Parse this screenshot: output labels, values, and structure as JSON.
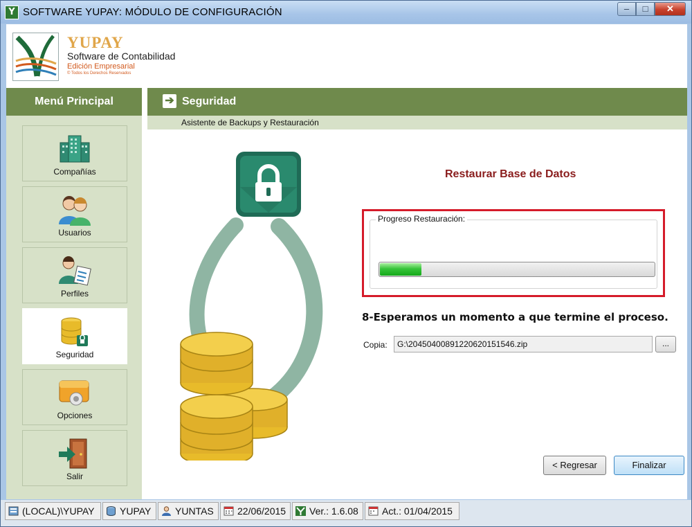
{
  "window": {
    "title": "SOFTWARE YUPAY: MÓDULO DE CONFIGURACIÓN",
    "app_icon": "Y",
    "controls": {
      "minimize": "–",
      "maximize": "□",
      "close": "✕"
    }
  },
  "header": {
    "brand": "YUPAY",
    "subtitle": "Software de Contabilidad",
    "edition": "Edición Empresarial",
    "rights": "© Todos los Derechos Reservados"
  },
  "sidebar": {
    "title": "Menú Principal",
    "items": [
      {
        "label": "Compañías",
        "icon": "buildings-icon"
      },
      {
        "label": "Usuarios",
        "icon": "users-icon"
      },
      {
        "label": "Perfiles",
        "icon": "profile-icon"
      },
      {
        "label": "Seguridad",
        "icon": "database-lock-icon",
        "active": true
      },
      {
        "label": "Opciones",
        "icon": "options-icon"
      },
      {
        "label": "Salir",
        "icon": "exit-door-icon"
      }
    ]
  },
  "main": {
    "section_title": "Seguridad",
    "section_subtitle": "Asistente de Backups y Restauración",
    "restore_title": "Restaurar Base de Datos",
    "progress_label": "Progreso Restauración:",
    "progress_fraction": 0.15,
    "note": "8-Esperamos un momento a que termine el proceso.",
    "copy_label": "Copia:",
    "copy_path": "G:\\20450400891220620151546.zip",
    "browse_label": "...",
    "back_button": "< Regresar",
    "finish_button": "Finalizar"
  },
  "status": {
    "server": "(LOCAL)\\YUPAY",
    "database": "YUPAY",
    "user": "YUNTAS",
    "date": "22/06/2015",
    "version": "Ver.: 1.6.08",
    "updated": "Act.: 01/04/2015"
  },
  "colors": {
    "header_green": "#6f8a4c",
    "sidebar_bg": "#d7e1c8",
    "title_red": "#8a1d1d",
    "highlight_red": "#d51b2a",
    "progress_green": "#37c43a"
  }
}
